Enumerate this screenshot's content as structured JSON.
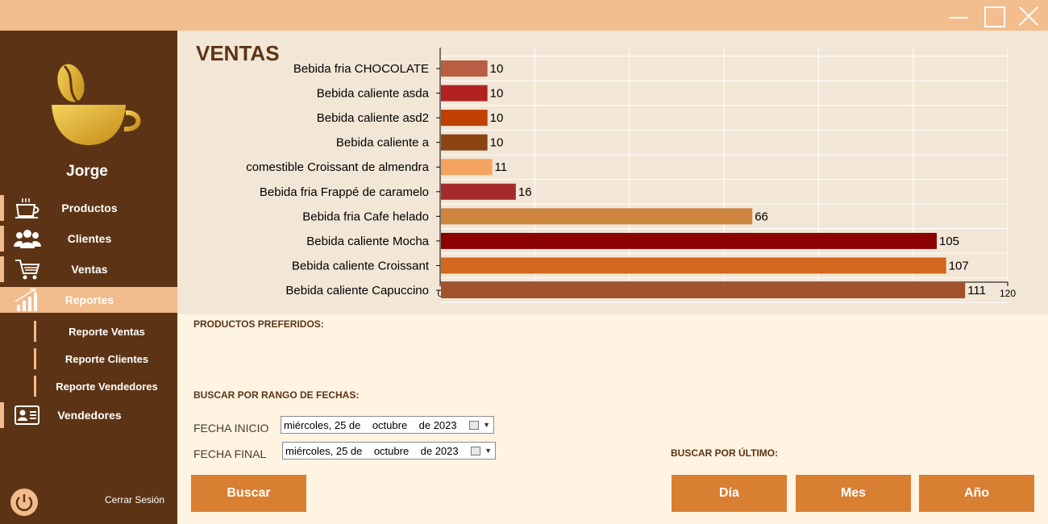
{
  "user": {
    "name": "Jorge"
  },
  "nav": {
    "items": [
      {
        "label": "Productos",
        "icon": "coffee-cup-icon"
      },
      {
        "label": "Clientes",
        "icon": "users-icon"
      },
      {
        "label": "Ventas",
        "icon": "cart-icon"
      },
      {
        "label": "Reportes",
        "icon": "chart-growth-icon"
      },
      {
        "label": "Vendedores",
        "icon": "id-card-icon"
      }
    ],
    "sub_items": [
      "Reporte Ventas",
      "Reporte Clientes",
      "Reporte Vendedores"
    ],
    "logout_label": "Cerrar Sesión"
  },
  "chart_title": "VENTAS",
  "chart_data": {
    "type": "bar",
    "orientation": "horizontal",
    "categories": [
      "Bebida fria CHOCOLATE",
      "Bebida caliente asda",
      "Bebida caliente asd2",
      "Bebida caliente a",
      "comestible Croissant de almendra",
      "Bebida fria Frappé de caramelo",
      "Bebida fria Cafe helado",
      "Bebida caliente Mocha",
      "Bebida caliente Croissant",
      "Bebida caliente Capuccino"
    ],
    "values": [
      10,
      10,
      10,
      10,
      11,
      16,
      66,
      105,
      107,
      111
    ],
    "colors": [
      "#b75e43",
      "#b22222",
      "#c04000",
      "#8b4513",
      "#f4a460",
      "#a52a2a",
      "#cd853f",
      "#8b0000",
      "#d2691e",
      "#a0522d"
    ],
    "xlim": [
      0,
      120
    ],
    "xticks": [
      0,
      20,
      40,
      60,
      80,
      100,
      120
    ],
    "grid": true
  },
  "form": {
    "preferidos_label": "PRODUCTOS PREFERIDOS:",
    "rango_label": "BUSCAR POR RANGO DE FECHAS:",
    "fecha_inicio_label": "FECHA INICIO",
    "fecha_inicio_value": "miércoles, 25 de    octubre    de 2023",
    "fecha_final_label": "FECHA FINAL",
    "fecha_final_value": "miércoles, 25 de    octubre    de 2023",
    "buscar_button": "Buscar",
    "ultimo_label": "BUSCAR POR ÚLTIMO:",
    "dia_button": "Día",
    "mes_button": "Mes",
    "anio_button": "Año"
  }
}
